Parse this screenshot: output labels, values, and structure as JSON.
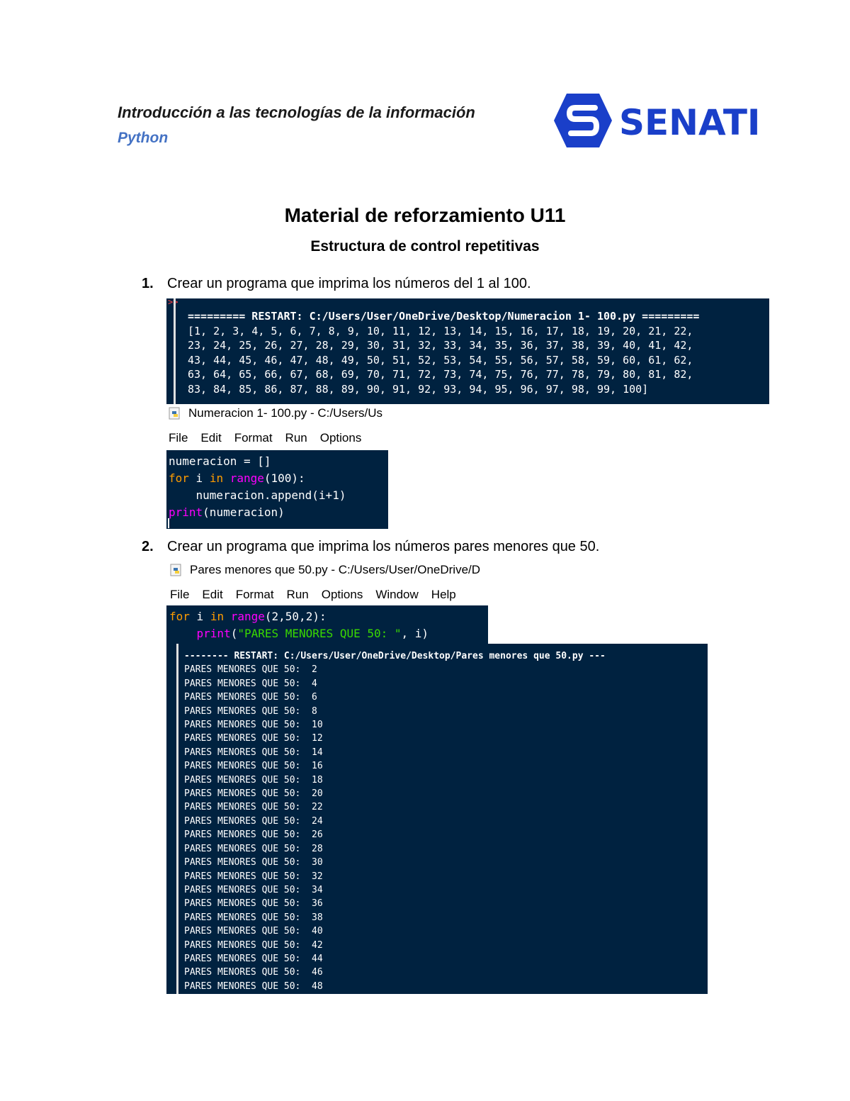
{
  "header": {
    "course": "Introducción a las tecnologías de la información",
    "subject": "Python",
    "logo_text": "SENATI",
    "logo_color": "#1a3fc9"
  },
  "title": "Material de reforzamiento U11",
  "subtitle": "Estructura de control repetitivas",
  "items": [
    {
      "number": "1.",
      "text": "Crear un programa que imprima los números del 1 al 100."
    },
    {
      "number": "2.",
      "text": "Crear un programa que imprima los números pares menores que 50."
    }
  ],
  "shell1": {
    "prompt": ">>",
    "lines": [
      "========= RESTART: C:/Users/User/OneDrive/Desktop/Numeracion 1- 100.py =========",
      "[1, 2, 3, 4, 5, 6, 7, 8, 9, 10, 11, 12, 13, 14, 15, 16, 17, 18, 19, 20, 21, 22,",
      "23, 24, 25, 26, 27, 28, 29, 30, 31, 32, 33, 34, 35, 36, 37, 38, 39, 40, 41, 42,",
      "43, 44, 45, 46, 47, 48, 49, 50, 51, 52, 53, 54, 55, 56, 57, 58, 59, 60, 61, 62,",
      "63, 64, 65, 66, 67, 68, 69, 70, 71, 72, 73, 74, 75, 76, 77, 78, 79, 80, 81, 82,",
      "83, 84, 85, 86, 87, 88, 89, 90, 91, 92, 93, 94, 95, 96, 97, 98, 99, 100]"
    ]
  },
  "editor1": {
    "title": "Numeracion 1- 100.py - C:/Users/Us",
    "menu": [
      "File",
      "Edit",
      "Format",
      "Run",
      "Options"
    ],
    "code": {
      "line1": "numeracion = []",
      "line2_kw": "for",
      "line2_a": " i ",
      "line2_in": "in",
      "line2_sp": " ",
      "line2_bi": "range",
      "line2_b": "(100):",
      "line3": "    numeracion.append(i+1)",
      "line4_bi": "print",
      "line4_b": "(numeracion)"
    }
  },
  "editor2": {
    "title": "Pares menores que 50.py - C:/Users/User/OneDrive/D",
    "menu": [
      "File",
      "Edit",
      "Format",
      "Run",
      "Options",
      "Window",
      "Help"
    ],
    "code": {
      "line1_kw": "for",
      "line1_a": " i ",
      "line1_in": "in",
      "line1_sp": " ",
      "line1_bi": "range",
      "line1_b": "(2,50,2):",
      "line2_indent": "    ",
      "line2_bi": "print",
      "line2_open": "(",
      "line2_str": "\"PARES MENORES QUE 50: \"",
      "line2_close": ", i)"
    }
  },
  "shell2": {
    "restart": "-------- RESTART: C:/Users/User/OneDrive/Desktop/Pares menores que 50.py ---",
    "lines": [
      "PARES MENORES QUE 50:  2",
      "PARES MENORES QUE 50:  4",
      "PARES MENORES QUE 50:  6",
      "PARES MENORES QUE 50:  8",
      "PARES MENORES QUE 50:  10",
      "PARES MENORES QUE 50:  12",
      "PARES MENORES QUE 50:  14",
      "PARES MENORES QUE 50:  16",
      "PARES MENORES QUE 50:  18",
      "PARES MENORES QUE 50:  20",
      "PARES MENORES QUE 50:  22",
      "PARES MENORES QUE 50:  24",
      "PARES MENORES QUE 50:  26",
      "PARES MENORES QUE 50:  28",
      "PARES MENORES QUE 50:  30",
      "PARES MENORES QUE 50:  32",
      "PARES MENORES QUE 50:  34",
      "PARES MENORES QUE 50:  36",
      "PARES MENORES QUE 50:  38",
      "PARES MENORES QUE 50:  40",
      "PARES MENORES QUE 50:  42",
      "PARES MENORES QUE 50:  44",
      "PARES MENORES QUE 50:  46",
      "PARES MENORES QUE 50:  48"
    ]
  }
}
